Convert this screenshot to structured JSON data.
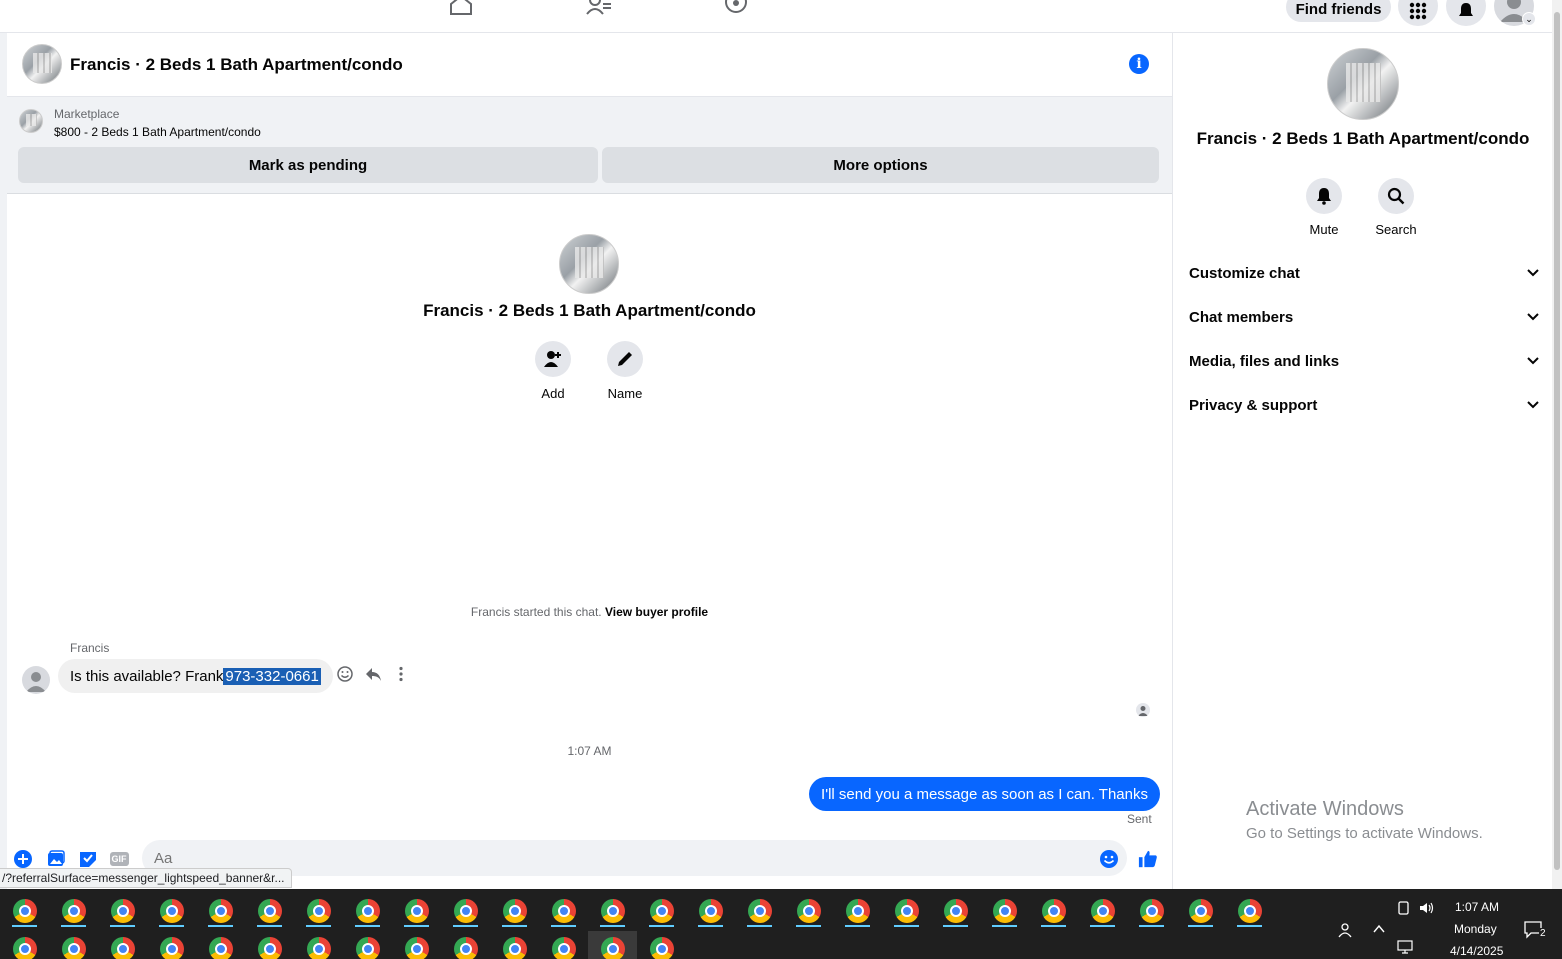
{
  "topnav": {
    "find_friends_label": "Find friends"
  },
  "chat": {
    "title": "Francis · 2 Beds 1 Bath Apartment/condo"
  },
  "marketplace": {
    "label": "Marketplace",
    "listing": "$800 - 2 Beds 1 Bath Apartment/condo",
    "mark_pending_label": "Mark as pending",
    "more_options_label": "More options"
  },
  "conversation": {
    "name": "Francis · 2 Beds 1 Bath Apartment/condo",
    "add_label": "Add",
    "name_label": "Name",
    "started_text": "Francis started this chat.",
    "view_buyer_link": "View buyer profile",
    "sender": "Francis",
    "incoming_text": "Is this available? Frank",
    "incoming_highlight": " 973-332-0661",
    "time": "1:07 AM",
    "outgoing_text": "I'll send you a message as soon as I can. Thanks",
    "status": "Sent"
  },
  "composer": {
    "placeholder": "Aa",
    "gif_label": "GIF"
  },
  "status_url": "/?referralSurface=messenger_lightspeed_banner&r...",
  "right_panel": {
    "name": "Francis · 2 Beds 1 Bath Apartment/condo",
    "mute_label": "Mute",
    "search_label": "Search",
    "sections": [
      "Customize chat",
      "Chat members",
      "Media, files and links",
      "Privacy & support"
    ]
  },
  "watermark": {
    "line1": "Activate Windows",
    "line2": "Go to Settings to activate Windows."
  },
  "taskbar": {
    "time": "1:07 AM",
    "day": "Monday",
    "date": "4/14/2025",
    "notification_count": "2"
  },
  "colors": {
    "accent": "#0866ff",
    "highlight": "#1a5fb4",
    "taskbar": "#1f1f1f"
  }
}
